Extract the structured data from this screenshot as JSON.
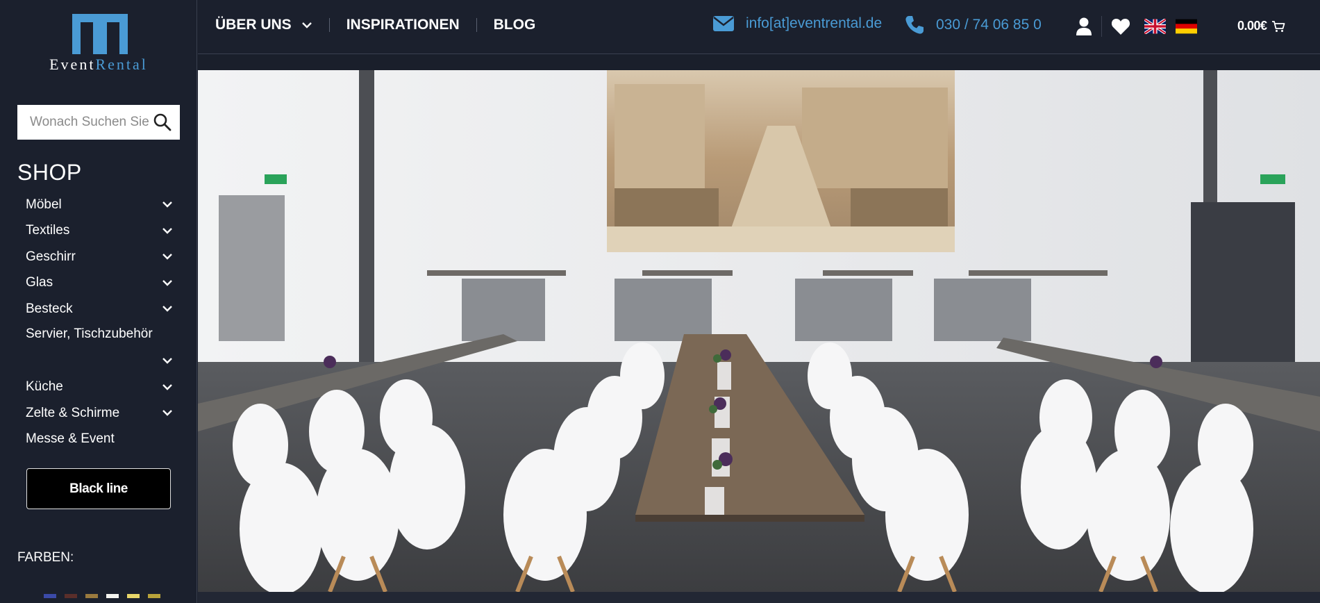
{
  "brand": {
    "name_part1": "Event",
    "name_part2": "Rental",
    "brand_color": "#4a9bd5"
  },
  "search": {
    "placeholder": "Wonach Suchen Sie?"
  },
  "shop": {
    "title": "SHOP",
    "categories": [
      {
        "label": "Möbel",
        "has_submenu": true
      },
      {
        "label": "Textiles",
        "has_submenu": true
      },
      {
        "label": "Geschirr",
        "has_submenu": true
      },
      {
        "label": "Glas",
        "has_submenu": true
      },
      {
        "label": "Besteck",
        "has_submenu": true
      },
      {
        "label": "Servier, Tischzubehör",
        "has_submenu": true
      },
      {
        "label": "Küche",
        "has_submenu": true
      },
      {
        "label": "Zelte & Schirme",
        "has_submenu": true
      },
      {
        "label": "Messe & Event",
        "has_submenu": false
      }
    ],
    "black_line_label": "Black line"
  },
  "filters": {
    "colors_label": "FARBEN:",
    "color_swatches": [
      "#3b4aa8",
      "#5a2e2a",
      "#9a7a3e",
      "#f4f4f0",
      "#e8d66a",
      "#b8a23a"
    ]
  },
  "nav": {
    "items": [
      {
        "label": "ÜBER UNS",
        "has_dropdown": true
      },
      {
        "label": "INSPIRATIONEN",
        "has_dropdown": false
      },
      {
        "label": "BLOG",
        "has_dropdown": false
      }
    ]
  },
  "contact": {
    "email": "info[at]eventrental.de",
    "phone": "030 / 74 06 85 0"
  },
  "header_icons": [
    "user-icon",
    "heart-icon",
    "flag-uk-icon",
    "flag-de-icon",
    "cart-icon"
  ],
  "cart": {
    "total": "0.00€"
  },
  "hero": {
    "description_icon": "hero-image"
  }
}
